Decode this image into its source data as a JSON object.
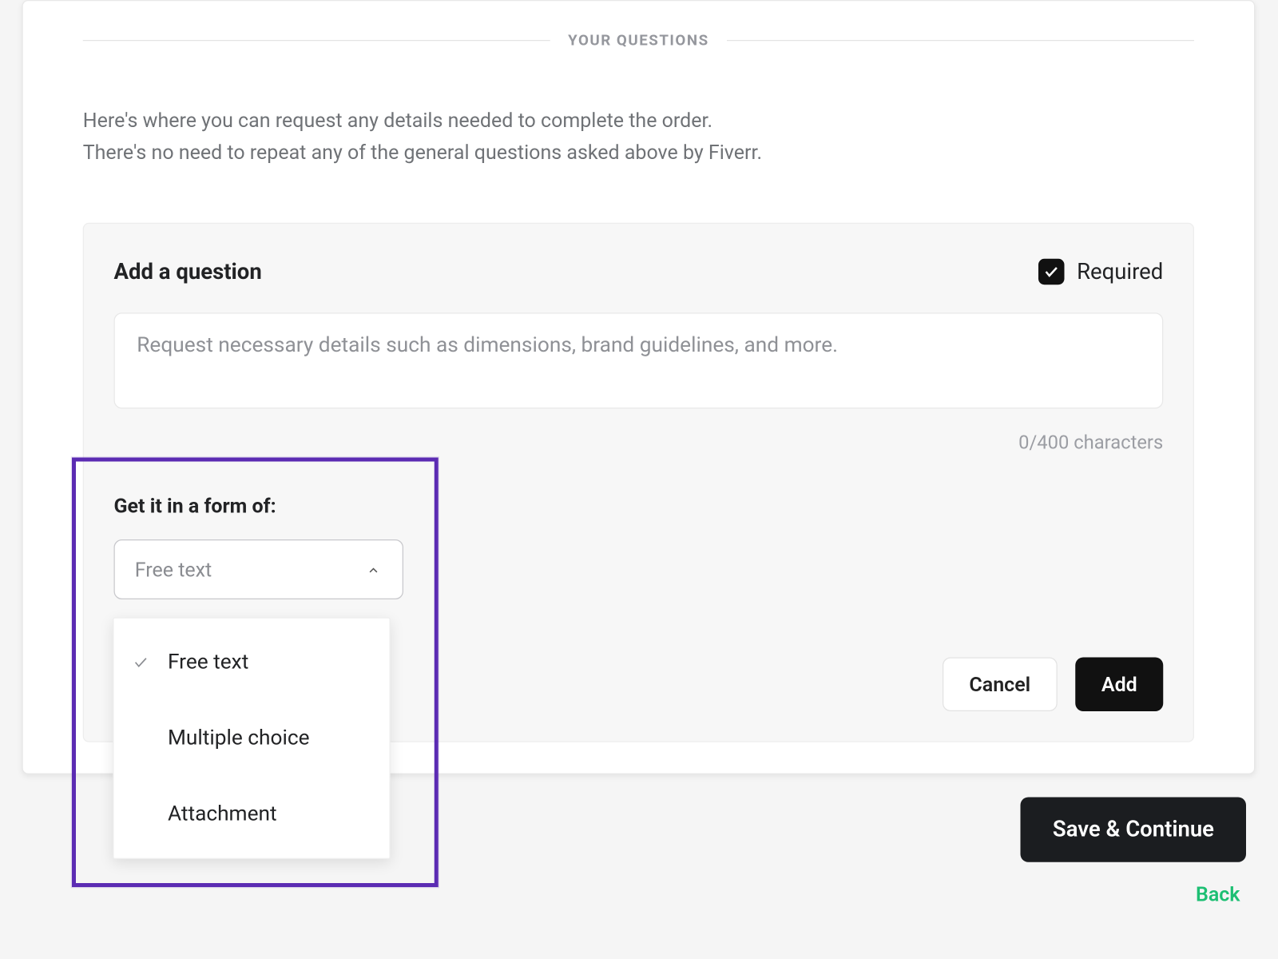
{
  "section_header": "YOUR QUESTIONS",
  "intro_line1": "Here's where you can request any details needed to complete the order.",
  "intro_line2": "There's no need to repeat any of the general questions asked above by Fiverr.",
  "panel": {
    "title": "Add a question",
    "required_label": "Required",
    "required_checked": true,
    "placeholder": "Request necessary details such as dimensions, brand guidelines, and more.",
    "value": "",
    "char_counter": "0/400 characters",
    "form_of_label": "Get it in a form of:",
    "dropdown_selected": "Free text",
    "dropdown_options": [
      {
        "label": "Free text",
        "selected": true
      },
      {
        "label": "Multiple choice",
        "selected": false
      },
      {
        "label": "Attachment",
        "selected": false
      }
    ],
    "cancel_label": "Cancel",
    "add_label": "Add"
  },
  "footer": {
    "save_label": "Save & Continue",
    "back_label": "Back"
  },
  "colors": {
    "accent_green": "#1dbf73",
    "highlight_purple": "#5b2bb3",
    "text_primary": "#222325",
    "text_muted": "#8f9196"
  }
}
